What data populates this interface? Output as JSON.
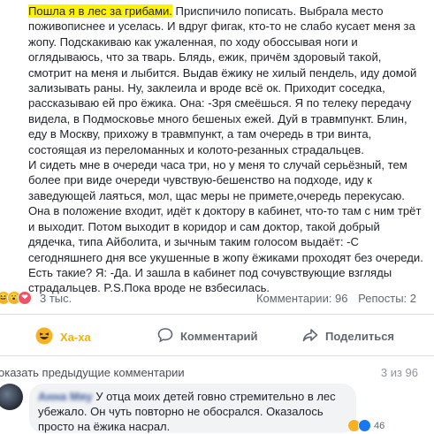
{
  "post": {
    "highlight": "Пошла я в лес за грибами.",
    "paragraphs": [
      " Приспичило пописать. Выбрала место поживописнее и уселась. И вдруг фигак, кто-то не слабо кусает меня за жопу. Подскакиваю как ужаленная, по ходу обоссывая ноги и оглядываюсь, что за тварь. Блядь, ежик, причём здоровый такой, смотрит на меня и лыбится. Выдав ёжику не хилый пендель, иду домой зализывать раны. Ну, заклеила и вроде всё ок. Приходит соседка, рассказываю ей про ёжика. Она: -Зря смеёшься. Я по телеку передачу видела, в Подмосковье много бешеных ежей. Дуй в травмпункт. Блин, еду в Москву, прихожу в травмпункт, а там очередь в три винта, состоящая из переломанных и колото-резанных страдальцев.",
      "И сидеть мне в очереди часа три, но у меня то случай серьёзный, тем более при виде очереди чувствую-бешенство на подходе, иду к заведующей лаяться, мол, щас меры не примете,очередь перекусаю. Она в положение входит, идёт к доктору в кабинет, что-то там с ним трёт и выходит. Потом выходит в коридор и сам доктор, такой добрый дядечка, типа Айболита, и зычным таким голосом выдаёт: -С сегодняшнего дня все укушенные в жопу ёжиками проходят без очереди. Есть такие? Я: -Да. И зашла в кабинет под сочувствующие взгляды страдальцев. P.S.Пока вроде не взбесилась."
    ]
  },
  "reactions": {
    "count": "3 тыс.",
    "comments": "Комментарии: 96",
    "reposts": "Репосты: 2"
  },
  "actions": {
    "haha": "Ха-ха",
    "comment": "Комментарий",
    "share": "Поделиться"
  },
  "comments_bar": {
    "show_previous": "оказать предыдущие комментарии",
    "counter": "3 из 96"
  },
  "comment": {
    "author": "Анна Мяу",
    "text": "У отца моих детей говно стремительно в лес убежало. Он чуть повторно не обосрался. Оказалось просто на ёжика насрал.",
    "reaction_count": "46"
  },
  "colors": {
    "highlight": "#fff200",
    "haha": "#f0b400",
    "link": "#385898"
  },
  "icons": [
    "haha-icon",
    "wow-icon",
    "love-icon",
    "comment-icon",
    "share-icon",
    "avatar"
  ]
}
